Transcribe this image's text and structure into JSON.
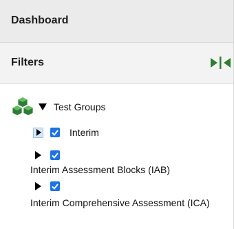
{
  "dashboard": {
    "title": "Dashboard"
  },
  "filters": {
    "title": "Filters"
  },
  "tree": {
    "root": {
      "label": "Test Groups",
      "icon": "cubes-icon",
      "expanded": true
    },
    "items": [
      {
        "label": "Interim",
        "checked": true,
        "expanded": false
      },
      {
        "label": "Interim Assessment Blocks (IAB)",
        "checked": true,
        "expanded": false
      },
      {
        "label": "Interim Comprehensive Assessment (ICA)",
        "checked": true,
        "expanded": false
      }
    ]
  },
  "colors": {
    "accent": "#1a73e8",
    "tree_icon": "#2e7d32",
    "toggle_icon": "#2e7d32",
    "header_bg": "#ebebeb",
    "filters_bg": "#f3f3f3"
  }
}
